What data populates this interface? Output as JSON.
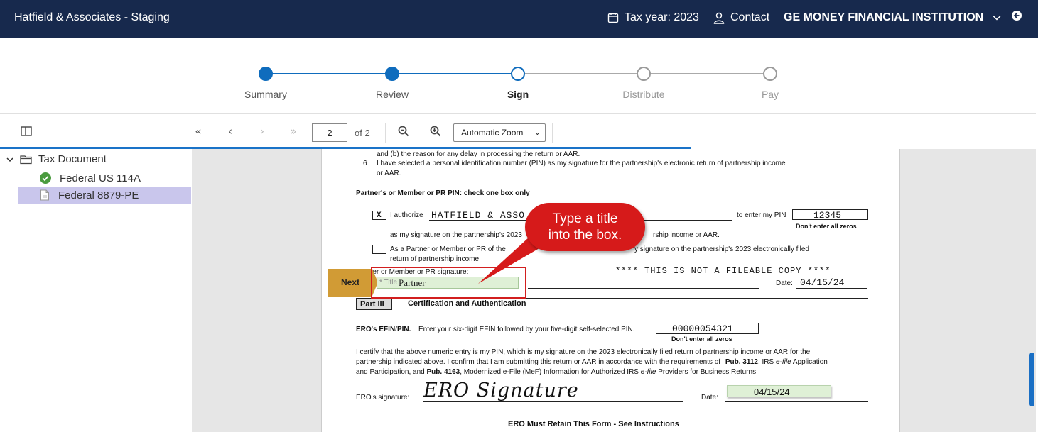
{
  "header": {
    "app_title": "Hatfield & Associates - Staging",
    "tax_year": "Tax year: 2023",
    "contact": "Contact",
    "organization": "GE MONEY FINANCIAL INSTITUTION"
  },
  "stepper": {
    "steps": [
      {
        "label": "Summary",
        "state": "done"
      },
      {
        "label": "Review",
        "state": "done"
      },
      {
        "label": "Sign",
        "state": "current"
      },
      {
        "label": "Distribute",
        "state": "todo"
      },
      {
        "label": "Pay",
        "state": "todo"
      }
    ]
  },
  "toolbar": {
    "page_number": "2",
    "page_of": "of 2",
    "zoom": "Automatic Zoom"
  },
  "sidebar": {
    "root": "Tax Document",
    "items": [
      {
        "label": "Federal US 114A",
        "status": "complete"
      },
      {
        "label": "Federal 8879-PE",
        "status": "selected"
      }
    ]
  },
  "document": {
    "line_top": "and (b) the reason for any delay in processing the return or AAR.",
    "line6_num": "6",
    "line6_a": "I have selected a personal identification number (PIN) as my signature for the partnership's electronic return of partnership income",
    "line6_b": "or AAR.",
    "pin_heading": "Partner's or Member or PR PIN: check one box only",
    "check_mark": "X",
    "authorize_label": "I authorize",
    "authorize_name": "HATFIELD & ASSO",
    "enter_pin_label": "to enter my PIN",
    "pin_value": "12345",
    "no_zeros_1": "Don't enter all zeros",
    "signature_line_a": "as my signature on the partnership's 2023",
    "signature_line_a_end": "rship income or AAR.",
    "alt_line_a": "As a Partner or Member or PR of the",
    "alt_line_a_end": "y signature on the partnership's 2023 electronically filed",
    "alt_line_b": "return of partnership income",
    "partner_sig_label": "tner or Member or PR signature:",
    "not_fileable": "**** THIS IS NOT A FILEABLE COPY ****",
    "title_placeholder": "* Title",
    "title_value": "Partner",
    "date_label": "Date:",
    "date_value": "04/15/24",
    "part3_label": "Part III",
    "part3_title": "Certification and Authentication",
    "ero_efin_label": "ERO's EFIN/PIN.",
    "ero_efin_text": "Enter your six-digit EFIN followed by your five-digit self-selected PIN.",
    "efin_value": "00000054321",
    "no_zeros_2": "Don't enter all zeros",
    "certify_1": "I certify that the above numeric entry is my PIN, which is my signature on the 2023 electronically filed return of partnership income or AAR for the",
    "certify_2a": "partnership indicated above. I confirm that I am submitting this return or AAR in accordance with the requirements of",
    "certify_2_pub": "Pub. 3112",
    "certify_2b": ", IRS",
    "certify_2_efile": "e-file",
    "certify_2c": "Application",
    "certify_3a": "and Participation, and",
    "certify_3_pub": "Pub. 4163",
    "certify_3b": ", Modernized e-File (MeF) Information for Authorized IRS",
    "certify_3_efile": "e-file",
    "certify_3c": "Providers for Business Returns.",
    "ero_sig_label": "ERO's signature:",
    "ero_sig_value": "ERO Signature",
    "ero_date_label": "Date:",
    "ero_date_value": "04/15/24",
    "footer": "ERO Must Retain This Form - See Instructions"
  },
  "overlay": {
    "next_label": "Next",
    "callout_line1": "Type a title",
    "callout_line2": "into the box."
  },
  "colors": {
    "header_bg": "#17294d",
    "accent": "#0f6cbd",
    "selected_bg": "#c9c6ec",
    "callout": "#d61a1a",
    "next_tab": "#d19b35",
    "field_bg": "#dff0d6"
  }
}
